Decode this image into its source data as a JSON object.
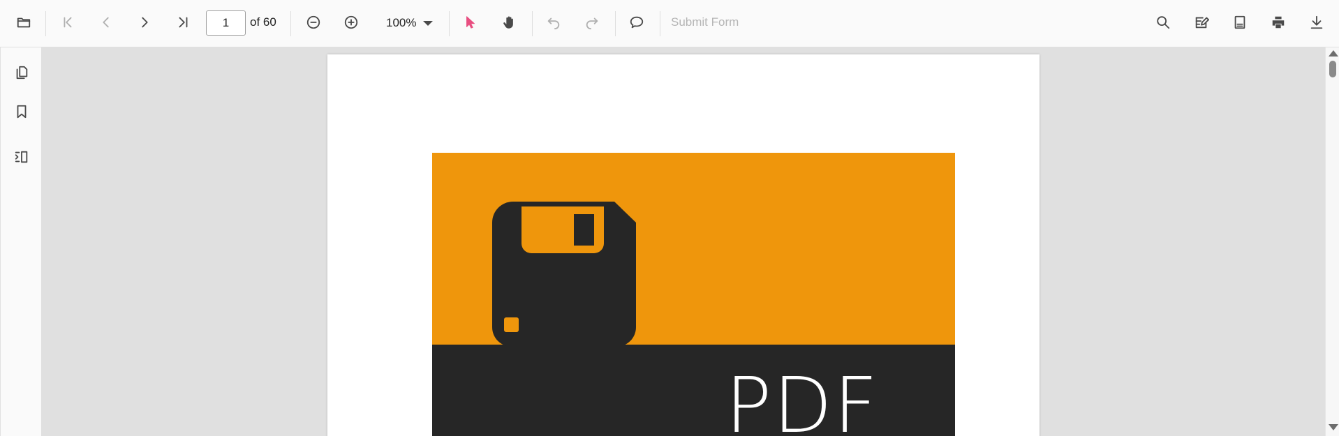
{
  "toolbar": {
    "icons": {
      "open": "folder-icon",
      "first_page": "first-page-icon",
      "previous_page": "previous-page-icon",
      "next_page": "next-page-icon",
      "last_page": "last-page-icon",
      "zoom_out": "zoom-out-icon",
      "zoom_in": "zoom-in-icon",
      "zoom_dropdown": "chevron-down-icon",
      "selection_tool": "cursor-arrow-icon",
      "pan_tool": "hand-icon",
      "undo": "undo-icon",
      "redo": "redo-icon",
      "comment": "comment-icon",
      "search": "search-icon",
      "annotate": "edit-annotation-icon",
      "form_designer": "form-designer-icon",
      "print": "print-icon",
      "download": "download-icon"
    },
    "current_page": "1",
    "page_total": "of 60",
    "zoom_value": "100%",
    "submit_form_label": "Submit Form",
    "colors": {
      "active_tool": "#e84e80",
      "icon": "#4a4a4a",
      "disabled_icon": "#b0b0b0"
    }
  },
  "sidebar": {
    "icons": {
      "thumbnails": "page-thumbnails-icon",
      "bookmarks": "bookmark-icon",
      "organize": "organize-pages-icon"
    }
  },
  "document": {
    "cover_title": "PDF",
    "colors": {
      "cover_top": "#ef960c",
      "cover_bottom": "#262626",
      "floppy_icon": "#262626"
    },
    "icons": {
      "cover_graphic": "floppy-disk-icon"
    }
  },
  "scrollbar": {
    "icons": {
      "up": "scroll-up-arrow-icon",
      "down": "scroll-down-arrow-icon"
    }
  }
}
